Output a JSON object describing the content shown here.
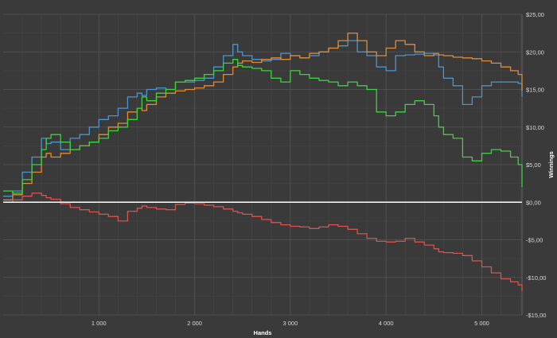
{
  "chart_data": {
    "type": "line",
    "xlabel": "Hands",
    "ylabel": "Winnings",
    "xlim": [
      0,
      5420
    ],
    "ylim": [
      -15,
      25
    ],
    "x_ticks": [
      1000,
      2000,
      3000,
      4000,
      5000
    ],
    "x_tick_labels": [
      "1 000",
      "2 000",
      "3 000",
      "4 000",
      "5 000"
    ],
    "y_ticks": [
      -15,
      -10,
      -5,
      0,
      5,
      10,
      15,
      20,
      25
    ],
    "y_tick_labels": [
      "-$15,00",
      "-$10,00",
      "-$5,00",
      "$0,00",
      "$5,00",
      "$10,00",
      "$15,00",
      "$20,00",
      "$25,00"
    ],
    "grid": true,
    "legend": "none",
    "background": "#3a3a3a",
    "grid_color": "#555555",
    "zero_line_color": "#ffffff",
    "series": [
      {
        "color": "#4d94d0",
        "x": [
          0,
          100,
          200,
          300,
          400,
          450,
          500,
          600,
          700,
          800,
          900,
          1000,
          1100,
          1200,
          1300,
          1400,
          1450,
          1500,
          1600,
          1700,
          1800,
          1900,
          2000,
          2100,
          2200,
          2300,
          2400,
          2450,
          2500,
          2600,
          2700,
          2800,
          2900,
          3000,
          3100,
          3200,
          3300,
          3400,
          3500,
          3600,
          3700,
          3800,
          3900,
          4000,
          4100,
          4200,
          4300,
          4400,
          4500,
          4550,
          4600,
          4700,
          4800,
          4900,
          5000,
          5100,
          5200,
          5300,
          5380,
          5420
        ],
        "y": [
          0.8,
          1.5,
          4,
          6,
          8.5,
          7.8,
          8,
          7,
          8.5,
          9,
          10,
          11,
          11.5,
          12.5,
          14,
          14.5,
          14.2,
          15,
          15.2,
          15,
          16,
          16,
          16.2,
          16.5,
          18,
          19.5,
          21,
          20,
          19.5,
          19,
          18.8,
          19,
          19.8,
          19.5,
          19.2,
          19.5,
          20,
          20.5,
          20.8,
          21.5,
          20,
          19.5,
          18,
          17.5,
          19.5,
          19.6,
          19.7,
          19.8,
          19.6,
          18,
          16.5,
          15.5,
          13,
          14,
          15.5,
          16,
          16,
          16,
          15.8,
          14
        ]
      },
      {
        "color": "#e08c35",
        "x": [
          0,
          100,
          200,
          300,
          400,
          450,
          500,
          600,
          700,
          800,
          900,
          1000,
          1100,
          1200,
          1300,
          1400,
          1450,
          1500,
          1600,
          1700,
          1800,
          1900,
          2000,
          2100,
          2200,
          2300,
          2400,
          2450,
          2500,
          2600,
          2700,
          2800,
          2900,
          3000,
          3100,
          3200,
          3300,
          3400,
          3500,
          3600,
          3700,
          3800,
          3900,
          4000,
          4100,
          4200,
          4300,
          4400,
          4500,
          4550,
          4600,
          4700,
          4800,
          4900,
          5000,
          5100,
          5200,
          5300,
          5380,
          5420
        ],
        "y": [
          0.3,
          1,
          2.5,
          4,
          6,
          6.5,
          6,
          6.5,
          7,
          7.5,
          8,
          9,
          10,
          10.5,
          12,
          12.5,
          12.2,
          13,
          14,
          14.5,
          14.8,
          15,
          15.2,
          15.5,
          16,
          17,
          18,
          18.5,
          18.8,
          18.6,
          19,
          19.2,
          19,
          19.5,
          19.2,
          19.8,
          20,
          20.5,
          21.5,
          22.5,
          21.5,
          20,
          19.5,
          20.5,
          21.5,
          21,
          20,
          19.5,
          19.8,
          19.6,
          19.5,
          19.3,
          19.2,
          19.1,
          18.8,
          18.5,
          18,
          17.5,
          17,
          14.8
        ]
      },
      {
        "color": "#3fd23f",
        "x": [
          0,
          100,
          200,
          300,
          400,
          450,
          500,
          600,
          700,
          800,
          900,
          1000,
          1100,
          1200,
          1300,
          1400,
          1450,
          1500,
          1600,
          1700,
          1800,
          1900,
          2000,
          2100,
          2200,
          2300,
          2400,
          2450,
          2500,
          2600,
          2700,
          2800,
          2900,
          3000,
          3100,
          3200,
          3300,
          3400,
          3500,
          3600,
          3700,
          3800,
          3900,
          4000,
          4100,
          4200,
          4300,
          4400,
          4500,
          4550,
          4600,
          4700,
          4800,
          4900,
          5000,
          5100,
          5200,
          5300,
          5380,
          5420
        ],
        "y": [
          1.5,
          1.2,
          3,
          5,
          7,
          8.5,
          9,
          8,
          7,
          7.5,
          8,
          8.5,
          9.5,
          10,
          11,
          12.5,
          14,
          13.5,
          14.5,
          15,
          16,
          16.2,
          16.5,
          17,
          17.5,
          18.5,
          19,
          18.2,
          18,
          17.8,
          17.5,
          16.5,
          16,
          17.5,
          17,
          16.5,
          16.2,
          16,
          15.5,
          16,
          15.5,
          15,
          12,
          11.5,
          12,
          13,
          13.5,
          13,
          11.5,
          10,
          9,
          8.5,
          6,
          5.5,
          6.5,
          7,
          6.8,
          6,
          5,
          2
        ]
      },
      {
        "color": "#d9534f",
        "x": [
          0,
          100,
          200,
          300,
          400,
          450,
          500,
          600,
          700,
          800,
          900,
          1000,
          1100,
          1200,
          1300,
          1400,
          1450,
          1500,
          1600,
          1700,
          1800,
          1900,
          2000,
          2100,
          2200,
          2300,
          2400,
          2450,
          2500,
          2600,
          2700,
          2800,
          2900,
          3000,
          3100,
          3200,
          3300,
          3400,
          3500,
          3600,
          3700,
          3800,
          3900,
          4000,
          4100,
          4200,
          4300,
          4400,
          4500,
          4550,
          4600,
          4700,
          4800,
          4900,
          5000,
          5100,
          5200,
          5300,
          5380,
          5420
        ],
        "y": [
          0,
          0.3,
          0.8,
          1.2,
          0.9,
          0.6,
          0.4,
          -0.2,
          -0.7,
          -1,
          -1.3,
          -1.6,
          -1.9,
          -2.5,
          -1.2,
          -0.8,
          -0.5,
          -0.7,
          -0.9,
          -1,
          -0.3,
          -0.1,
          -0.2,
          -0.4,
          -0.6,
          -0.9,
          -1.2,
          -1.4,
          -1.6,
          -1.9,
          -2.3,
          -2.7,
          -3,
          -3.2,
          -3.3,
          -3.5,
          -3.3,
          -3,
          -3.2,
          -3.6,
          -4.2,
          -4.8,
          -5.2,
          -5.3,
          -5.2,
          -4.8,
          -5.3,
          -5.7,
          -6.2,
          -6.6,
          -6.7,
          -6.8,
          -7.1,
          -7.8,
          -8.6,
          -9.4,
          -10.2,
          -10.6,
          -11,
          -11.8
        ]
      }
    ]
  }
}
